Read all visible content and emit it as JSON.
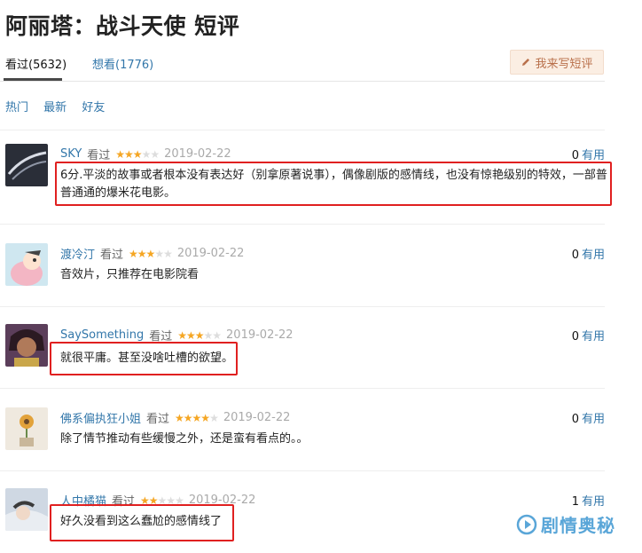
{
  "title": "阿丽塔：战斗天使 短评",
  "tabs": {
    "watched": "看过(5632)",
    "want": "想看(1776)"
  },
  "write_button": "我来写短评",
  "filters": [
    "热门",
    "最新",
    "好友"
  ],
  "status_word": "看过",
  "useful_word": "有用",
  "comments": [
    {
      "user": "SKY",
      "stars": 3,
      "date": "2019-02-22",
      "votes": "0",
      "text": "6分.平淡的故事或者根本没有表达好（别拿原著说事），偶像剧版的感情线，也没有惊艳级别的特效，一部普普通通的爆米花电影。"
    },
    {
      "user": "渡冷汀",
      "stars": 3,
      "date": "2019-02-22",
      "votes": "0",
      "text": "音效片，只推荐在电影院看"
    },
    {
      "user": "SaySomething",
      "stars": 3,
      "date": "2019-02-22",
      "votes": "0",
      "text": "就很平庸。甚至没啥吐槽的欲望。"
    },
    {
      "user": "佛系偏执狂小姐",
      "stars": 4,
      "date": "2019-02-22",
      "votes": "0",
      "text": "除了情节推动有些缓慢之外，还是蛮有看点的。。"
    },
    {
      "user": "人中橘猫",
      "stars": 2,
      "date": "2019-02-22",
      "votes": "1",
      "text": "好久没看到这么蠢尬的感情线了"
    }
  ],
  "watermark": "剧情奥秘",
  "colors": {
    "link": "#3377aa",
    "star": "#f5a623",
    "highlight": "#e02020",
    "watermark": "#5aa6d8"
  }
}
